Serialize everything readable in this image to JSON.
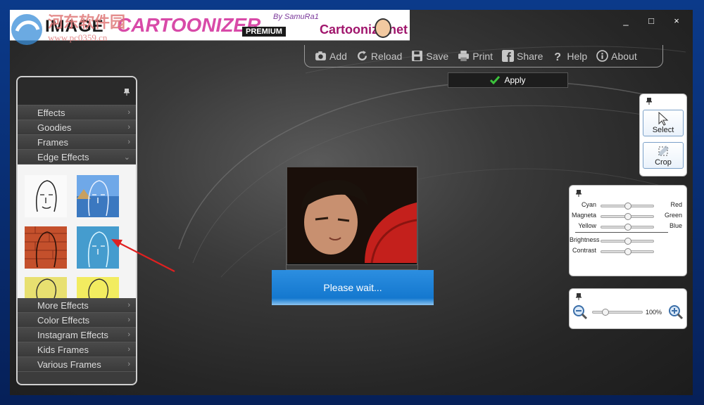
{
  "watermark": {
    "line1": "河东软件园",
    "line2": "www.pc0359.cn"
  },
  "logo": {
    "image": "IMAGE",
    "cartoonizer": "CARTOONIZER",
    "by": "By SamuRa1",
    "premium": "PREMIUM",
    "site": "Cartoonize  net"
  },
  "window_controls": {
    "minimize": "_",
    "maximize": "□",
    "close": "×"
  },
  "toolbar": [
    {
      "label": "Add",
      "icon": "camera-add-icon"
    },
    {
      "label": "Reload",
      "icon": "reload-icon"
    },
    {
      "label": "Save",
      "icon": "floppy-disk-icon"
    },
    {
      "label": "Print",
      "icon": "printer-icon"
    },
    {
      "label": "Share",
      "icon": "facebook-icon"
    },
    {
      "label": "Help",
      "icon": "question-icon"
    },
    {
      "label": "About",
      "icon": "info-icon"
    }
  ],
  "apply": {
    "label": "Apply"
  },
  "left_menu": {
    "top": [
      {
        "label": "Effects",
        "arrow": "›"
      },
      {
        "label": "Goodies",
        "arrow": "›"
      },
      {
        "label": "Frames",
        "arrow": "›"
      },
      {
        "label": "Edge Effects",
        "arrow": "⌄"
      }
    ],
    "bottom": [
      {
        "label": "More Effects",
        "arrow": "›"
      },
      {
        "label": "Color Effects",
        "arrow": "›"
      },
      {
        "label": "Instagram Effects",
        "arrow": "›"
      },
      {
        "label": "Kids Frames",
        "arrow": "›"
      },
      {
        "label": "Various Frames",
        "arrow": "›"
      }
    ]
  },
  "center": {
    "wait_text": "Please wait..."
  },
  "tools": {
    "select": "Select",
    "crop": "Crop"
  },
  "color_sliders": [
    {
      "left": "Cyan",
      "right": "Red",
      "value": 0.5
    },
    {
      "left": "Magneta",
      "right": "Green",
      "value": 0.5
    },
    {
      "left": "Yellow",
      "right": "Blue",
      "value": 0.5
    }
  ],
  "tone_sliders": [
    {
      "left": "Brightness",
      "value": 0.5
    },
    {
      "left": "Contrast",
      "value": 0.5
    }
  ],
  "zoom": {
    "value_text": "100%",
    "value": 0.25
  },
  "colors": {
    "accent": "#1478cf",
    "apply_check": "#3cc43c",
    "annotation_arrow": "#e02020"
  }
}
